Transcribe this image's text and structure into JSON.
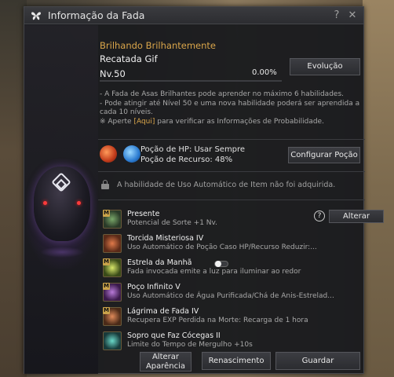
{
  "window": {
    "title": "Informação da Fada"
  },
  "fairy": {
    "title_line": "Brilhando Brilhantemente",
    "name": "Recatada Gif",
    "level": "Nv.50",
    "exp_percent": "0.00%",
    "exp_fraction": 0.0,
    "evolution_button": "Evolução"
  },
  "description": {
    "line1": "- A Fada de Asas Brilhantes pode aprender no máximo 6 habilidades.",
    "line2": "- Pode atingir até Nível 50 e uma nova habilidade poderá ser aprendida a cada 10 níveis.",
    "prob_prefix": "※ Aperte ",
    "prob_link": "[Aqui]",
    "prob_suffix": " para verificar as Informações de Probabilidade."
  },
  "potion": {
    "hp_label": "Poção de HP: Usar Sempre",
    "resource_label": "Poção de Recurso: 48%",
    "configure_button": "Configurar Poção"
  },
  "auto_use": {
    "text": "A habilidade de Uso Automático de Item não foi adquirida."
  },
  "skills": [
    {
      "name": "Presente",
      "desc": "Potencial de Sorte +1 Nv."
    },
    {
      "name": "Torcida Misteriosa IV",
      "desc": "Uso Automático de Poção Caso HP/Recurso Reduzir:..."
    },
    {
      "name": "Estrela da Manhã",
      "desc": "Fada invocada emite a luz para iluminar ao redor"
    },
    {
      "name": "Poço Infinito V",
      "desc": "Uso Automático de Água Purificada/Chá de Anis-Estrelad..."
    },
    {
      "name": "Lágrima de Fada IV",
      "desc": "Recupera EXP Perdida na Morte: Recarga de 1 hora"
    },
    {
      "name": "Sopro que Faz Cócegas II",
      "desc": "Limite do Tempo de Mergulho +10s"
    }
  ],
  "skill_badge": "M",
  "help_symbol": "?",
  "change_button": "Alterar",
  "footer": {
    "appearance_line1": "Alterar",
    "appearance_line2": "Aparência",
    "rebirth": "Renascimento",
    "save": "Guardar"
  },
  "colors": {
    "accent_gold": "#d9a54a",
    "panel_bg": "#1a1b1e"
  }
}
